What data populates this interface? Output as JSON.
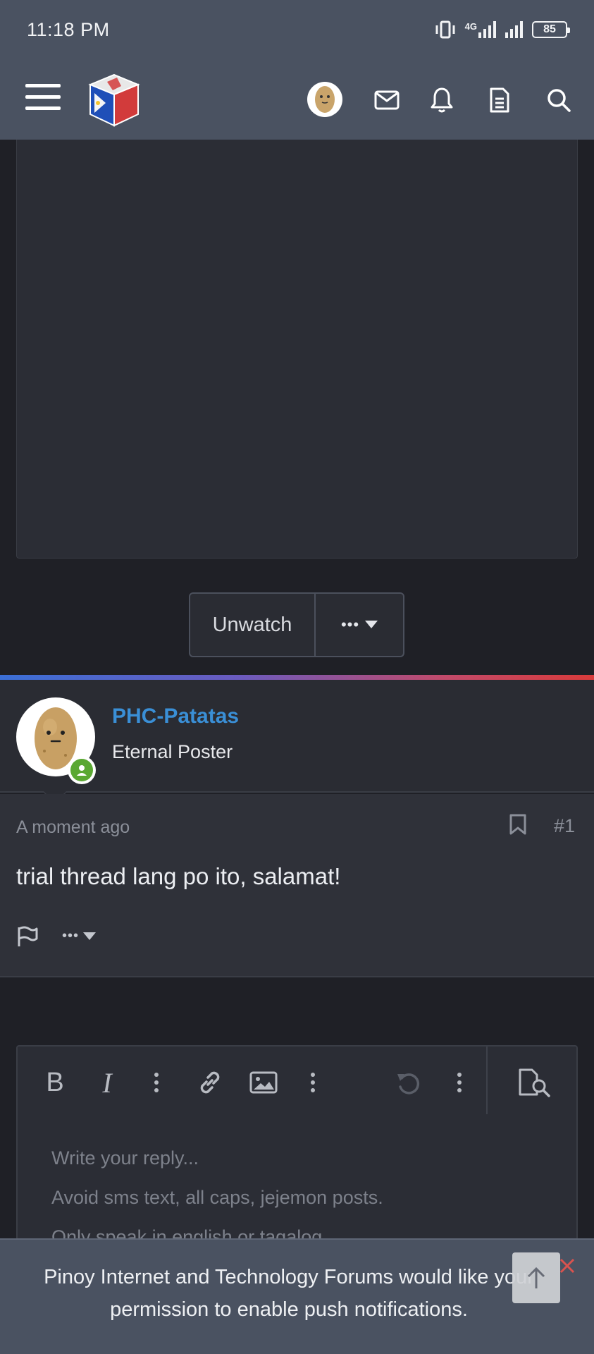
{
  "status_bar": {
    "time": "11:18 PM",
    "network": "4G",
    "battery": "85"
  },
  "header": {
    "icons": [
      "menu-icon",
      "site-logo",
      "avatar",
      "mail-icon",
      "bell-icon",
      "document-icon",
      "search-icon"
    ]
  },
  "thread_actions": {
    "unwatch_label": "Unwatch",
    "more_label": "•••"
  },
  "post": {
    "username": "PHC-Patatas",
    "user_title": "Eternal Poster",
    "time": "A moment ago",
    "number": "#1",
    "text": "trial thread lang po ito, salamat!",
    "more_label": "•••"
  },
  "editor": {
    "placeholder_lines": [
      "Write your reply...",
      "Avoid sms text, all caps, jejemon posts.",
      "Only speak in english or tagalog."
    ],
    "toolbar": [
      "bold-icon",
      "italic-icon",
      "more-vertical-icon",
      "link-icon",
      "image-icon",
      "more-vertical-icon",
      "undo-icon",
      "more-vertical-icon",
      "preview-icon"
    ]
  },
  "push_notification": {
    "text": "Pinoy Internet and Technology Forums would like your permission to enable push notifications."
  },
  "colors": {
    "header_bg": "#4a5261",
    "username": "#3a8fd6",
    "online": "#5aa832",
    "close": "#d9534f"
  }
}
